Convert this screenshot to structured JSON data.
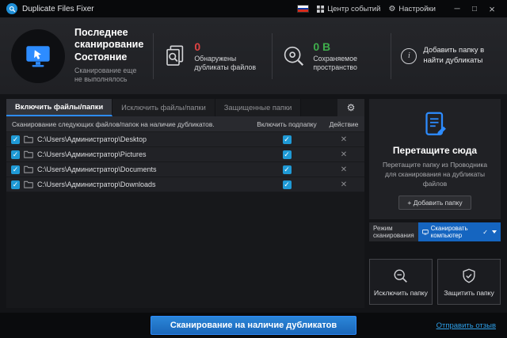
{
  "titlebar": {
    "app_title": "Duplicate Files Fixer",
    "events_center": "Центр событий",
    "settings": "Настройки",
    "window_controls": {
      "minimize": "─",
      "maximize": "□",
      "close": "×"
    },
    "icons": {
      "app": "magnifier-badge",
      "flag": "russian-flag",
      "events": "grid-icon",
      "settings": "gear-icon"
    }
  },
  "header": {
    "last_scan": {
      "title": "Последнее сканирование Состояние",
      "subtitle": "Сканирование еще не выполнялось",
      "icon": "monitor-cursor-icon"
    },
    "duplicates": {
      "value": "0",
      "label": "Обнаружены дубликаты файлов",
      "value_color": "#e04343",
      "icon": "documents-magnifier-icon"
    },
    "space": {
      "value": "0 B",
      "label": "Сохраняемое пространство",
      "value_color": "#3fae4c",
      "icon": "disk-magnifier-icon"
    },
    "add_folder": {
      "label": "Добавить папку в найти дубликаты",
      "icon": "info-icon",
      "info_glyph": "i"
    }
  },
  "tabs": [
    {
      "label": "Включить файлы/папки",
      "active": true
    },
    {
      "label": "Исключить файлы/папки",
      "active": false
    },
    {
      "label": "Защищенные папки",
      "active": false
    }
  ],
  "table": {
    "headers": {
      "main": "Сканирование следующих файлов/папок на наличие дубликатов.",
      "subfolder": "Включить подпапку",
      "action": "Действие"
    },
    "rows": [
      {
        "path": "C:\\Users\\Администратор\\Desktop",
        "checked": true,
        "subfolder_checked": true
      },
      {
        "path": "C:\\Users\\Администратор\\Pictures",
        "checked": true,
        "subfolder_checked": true
      },
      {
        "path": "C:\\Users\\Администратор\\Documents",
        "checked": true,
        "subfolder_checked": true
      },
      {
        "path": "C:\\Users\\Администратор\\Downloads",
        "checked": true,
        "subfolder_checked": true
      }
    ]
  },
  "dropzone": {
    "title": "Перетащите сюда",
    "description": "Перетащите папку из Проводника для сканирования на дубликаты файлов",
    "add_button": "+ Добавить папку",
    "icon": "document-pencil-icon"
  },
  "scan_mode": {
    "label": "Режим сканирования",
    "selected": "Сканировать компьютер",
    "icons": [
      "computer-icon",
      "check-icon",
      "chevron-down-icon"
    ]
  },
  "side_buttons": {
    "exclude": {
      "label": "Исключить папку",
      "icon": "magnifier-minus-icon"
    },
    "protect": {
      "label": "Защитить папку",
      "icon": "shield-icon"
    }
  },
  "footer": {
    "scan_button": "Сканирование на наличие дубликатов",
    "feedback_link": "Отправить отзыв"
  }
}
